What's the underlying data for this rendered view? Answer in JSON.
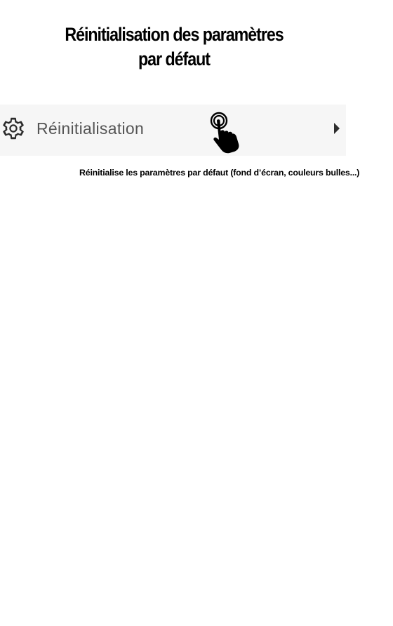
{
  "title": {
    "line1": "Réinitialisation des paramètres",
    "line2": "par défaut"
  },
  "settings_row": {
    "icon": "gear-icon",
    "label": "Réinitialisation",
    "trailing_icon": "chevron-right-icon",
    "overlay_icon": "tap-hand-icon",
    "background": "#f6f6f6",
    "label_color": "#555555"
  },
  "caption": "Réinitialise les paramètres par défaut (fond d’écran, couleurs bulles...)"
}
